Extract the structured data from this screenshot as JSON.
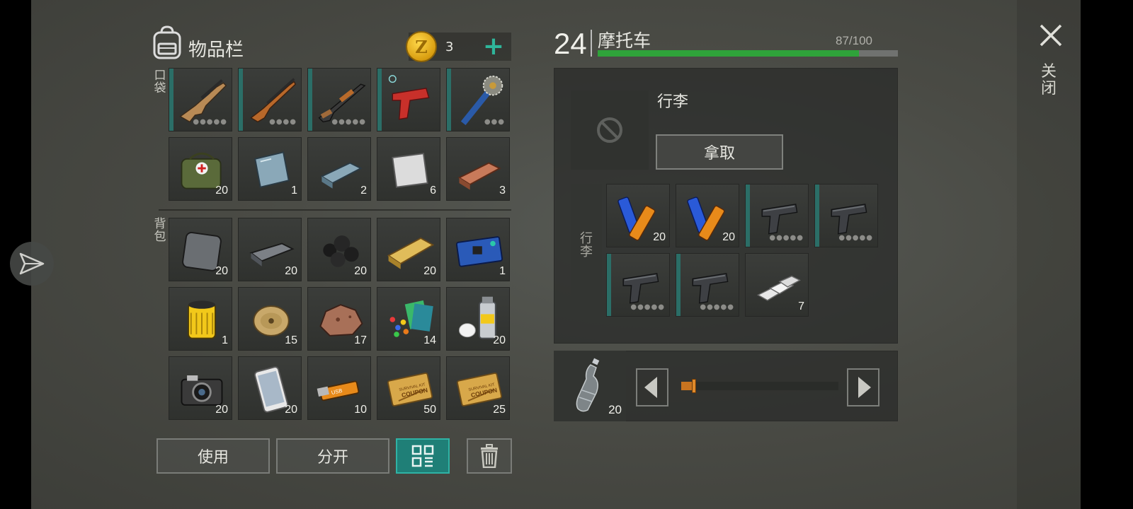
{
  "inventory": {
    "title": "物品栏",
    "coins": "3",
    "add_icon": "plus-icon",
    "pocket_label": "口袋",
    "backpack_label": "背包",
    "pocket_items": [
      {
        "name": "scar-rifle",
        "dots": "●●●●●",
        "bar": true
      },
      {
        "name": "dragunov-rifle",
        "dots": "●●●●",
        "bar": true
      },
      {
        "name": "pump-shotgun",
        "dots": "●●●●●",
        "bar": true
      },
      {
        "name": "flare-gun",
        "dots": "",
        "bar": true
      },
      {
        "name": "saw-mace",
        "dots": "●●●",
        "bar": true
      },
      {
        "name": "medical-bag",
        "count": "20"
      },
      {
        "name": "glass-sheet",
        "count": "1"
      },
      {
        "name": "steel-ingot",
        "count": "2"
      },
      {
        "name": "aluminum-sheet",
        "count": "6"
      },
      {
        "name": "copper-ingot",
        "count": "3"
      }
    ],
    "backpack_items": [
      {
        "name": "iron-plate",
        "count": "20"
      },
      {
        "name": "iron-bar",
        "count": "20"
      },
      {
        "name": "coal",
        "count": "20"
      },
      {
        "name": "wood-plank",
        "count": "20"
      },
      {
        "name": "circuit-board",
        "count": "1"
      },
      {
        "name": "oil-filter",
        "count": "1"
      },
      {
        "name": "wire-spool",
        "count": "15"
      },
      {
        "name": "ore-rock",
        "count": "17"
      },
      {
        "name": "plastic-and-paper",
        "count": "14"
      },
      {
        "name": "spray-paint",
        "count": "20"
      },
      {
        "name": "camera",
        "count": "20"
      },
      {
        "name": "smartphone",
        "count": "20"
      },
      {
        "name": "usb-drive",
        "count": "10"
      },
      {
        "name": "survival-coupon",
        "count": "50"
      },
      {
        "name": "survival-coupon",
        "count": "25"
      }
    ],
    "coupon_line1": "SURVIVAL KIT",
    "coupon_line2": "COUPON"
  },
  "actions": {
    "use_label": "使用",
    "split_label": "分开"
  },
  "vehicle": {
    "level": "24",
    "name": "摩托车",
    "durability_text": "87/100",
    "durability": 0.87,
    "luggage_title": "行李",
    "take_label": "拿取",
    "cargo_label": "行李",
    "cargo_items": [
      {
        "name": "batteries",
        "count": "20"
      },
      {
        "name": "batteries",
        "count": "20"
      },
      {
        "name": "pistol",
        "dots": "●●●●●",
        "bar": true
      },
      {
        "name": "pistol",
        "dots": "●●●●●",
        "bar": true
      },
      {
        "name": "pistol",
        "dots": "●●●●●",
        "bar": true
      },
      {
        "name": "pistol",
        "dots": "●●●●●",
        "bar": true
      },
      {
        "name": "silver-bars",
        "count": "7"
      }
    ],
    "quick_item": {
      "name": "water-bottle",
      "count": "20"
    },
    "slider_fraction": 0.08
  },
  "close": {
    "label": "关闭",
    "icon": "close-icon"
  },
  "colors": {
    "teal": "#2fb3a5",
    "durability_green": "#2fa33a",
    "slider_orange": "#c87420",
    "gold": "#ffd84a"
  }
}
